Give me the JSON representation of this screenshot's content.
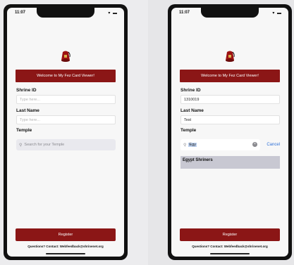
{
  "status": {
    "time": "11:07",
    "icons": "wifi-battery"
  },
  "left": {
    "welcome": "Welcome to My Fez Card Viewer!",
    "shrine_label": "Shrine ID",
    "shrine_placeholder": "Type here...",
    "last_name_label": "Last Name",
    "last_name_placeholder": "Type here...",
    "temple_label": "Temple",
    "search_placeholder": "Search for your Temple",
    "register": "Register",
    "footer": "Questions? Contact: Webfeedback@shrinenet.org"
  },
  "right": {
    "welcome": "Welcome to My Fez Card Viewer!",
    "shrine_label": "Shrine ID",
    "shrine_value": "1310019",
    "last_name_label": "Last Name",
    "last_name_value": "Test",
    "temple_label": "Temple",
    "search_value": "Egy",
    "cancel": "Cancel",
    "result": "Egypt Shriners",
    "register": "Register",
    "footer": "Questions? Contact: Webfeedback@shrinenet.org"
  },
  "colors": {
    "brand": "#8b1616",
    "link": "#2d6fd6"
  }
}
